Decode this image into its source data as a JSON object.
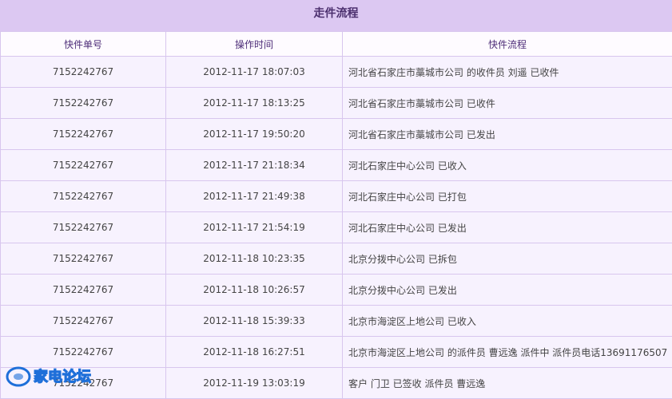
{
  "page": {
    "title": "走件流程"
  },
  "table": {
    "headers": [
      "快件单号",
      "操作时间",
      "快件流程"
    ],
    "rows": [
      {
        "waybill": "7152242767",
        "time": "2012-11-17 18:07:03",
        "flow": "河北省石家庄市藁城市公司 的收件员 刘遥 已收件"
      },
      {
        "waybill": "7152242767",
        "time": "2012-11-17 18:13:25",
        "flow": "河北省石家庄市藁城市公司 已收件"
      },
      {
        "waybill": "7152242767",
        "time": "2012-11-17 19:50:20",
        "flow": "河北省石家庄市藁城市公司 已发出"
      },
      {
        "waybill": "7152242767",
        "time": "2012-11-17 21:18:34",
        "flow": "河北石家庄中心公司 已收入"
      },
      {
        "waybill": "7152242767",
        "time": "2012-11-17 21:49:38",
        "flow": "河北石家庄中心公司 已打包"
      },
      {
        "waybill": "7152242767",
        "time": "2012-11-17 21:54:19",
        "flow": "河北石家庄中心公司 已发出"
      },
      {
        "waybill": "7152242767",
        "time": "2012-11-18 10:23:35",
        "flow": "北京分拨中心公司 已拆包"
      },
      {
        "waybill": "7152242767",
        "time": "2012-11-18 10:26:57",
        "flow": "北京分拨中心公司 已发出"
      },
      {
        "waybill": "7152242767",
        "time": "2012-11-18 15:39:33",
        "flow": "北京市海淀区上地公司 已收入"
      },
      {
        "waybill": "7152242767",
        "time": "2012-11-18 16:27:51",
        "flow": "北京市海淀区上地公司 的派件员 曹远逸 派件中 派件员电话13691176507"
      },
      {
        "waybill": "7152242767",
        "time": "2012-11-19 13:03:19",
        "flow": "客户 门卫 已签收 派件员 曹远逸"
      }
    ]
  },
  "watermark": {
    "text": "家电论坛",
    "color": "#1e6fd9"
  }
}
